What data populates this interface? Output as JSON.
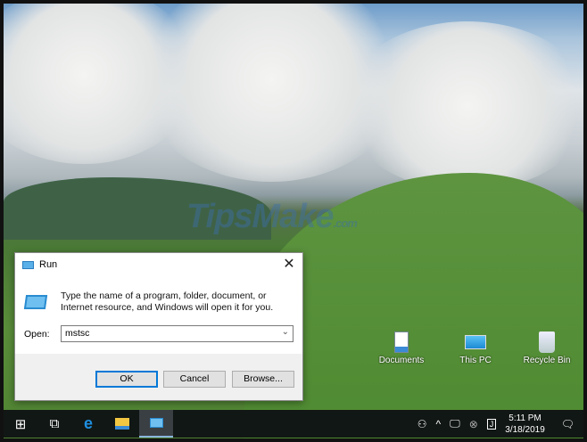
{
  "watermark": {
    "main": "TipsMake",
    "suffix": ".com"
  },
  "desktop_icons": [
    {
      "label": "Documents",
      "icon": "documents-icon"
    },
    {
      "label": "This PC",
      "icon": "this-pc-icon"
    },
    {
      "label": "Recycle Bin",
      "icon": "recycle-bin-icon"
    }
  ],
  "run_dialog": {
    "title": "Run",
    "close": "✕",
    "message": "Type the name of a program, folder, document, or Internet resource, and Windows will open it for you.",
    "open_label": "Open:",
    "open_value": "mstsc",
    "ok": "OK",
    "cancel": "Cancel",
    "browse": "Browse..."
  },
  "taskbar": {
    "time": "5:11 PM",
    "date": "3/18/2019",
    "accent": "#0078d7"
  }
}
